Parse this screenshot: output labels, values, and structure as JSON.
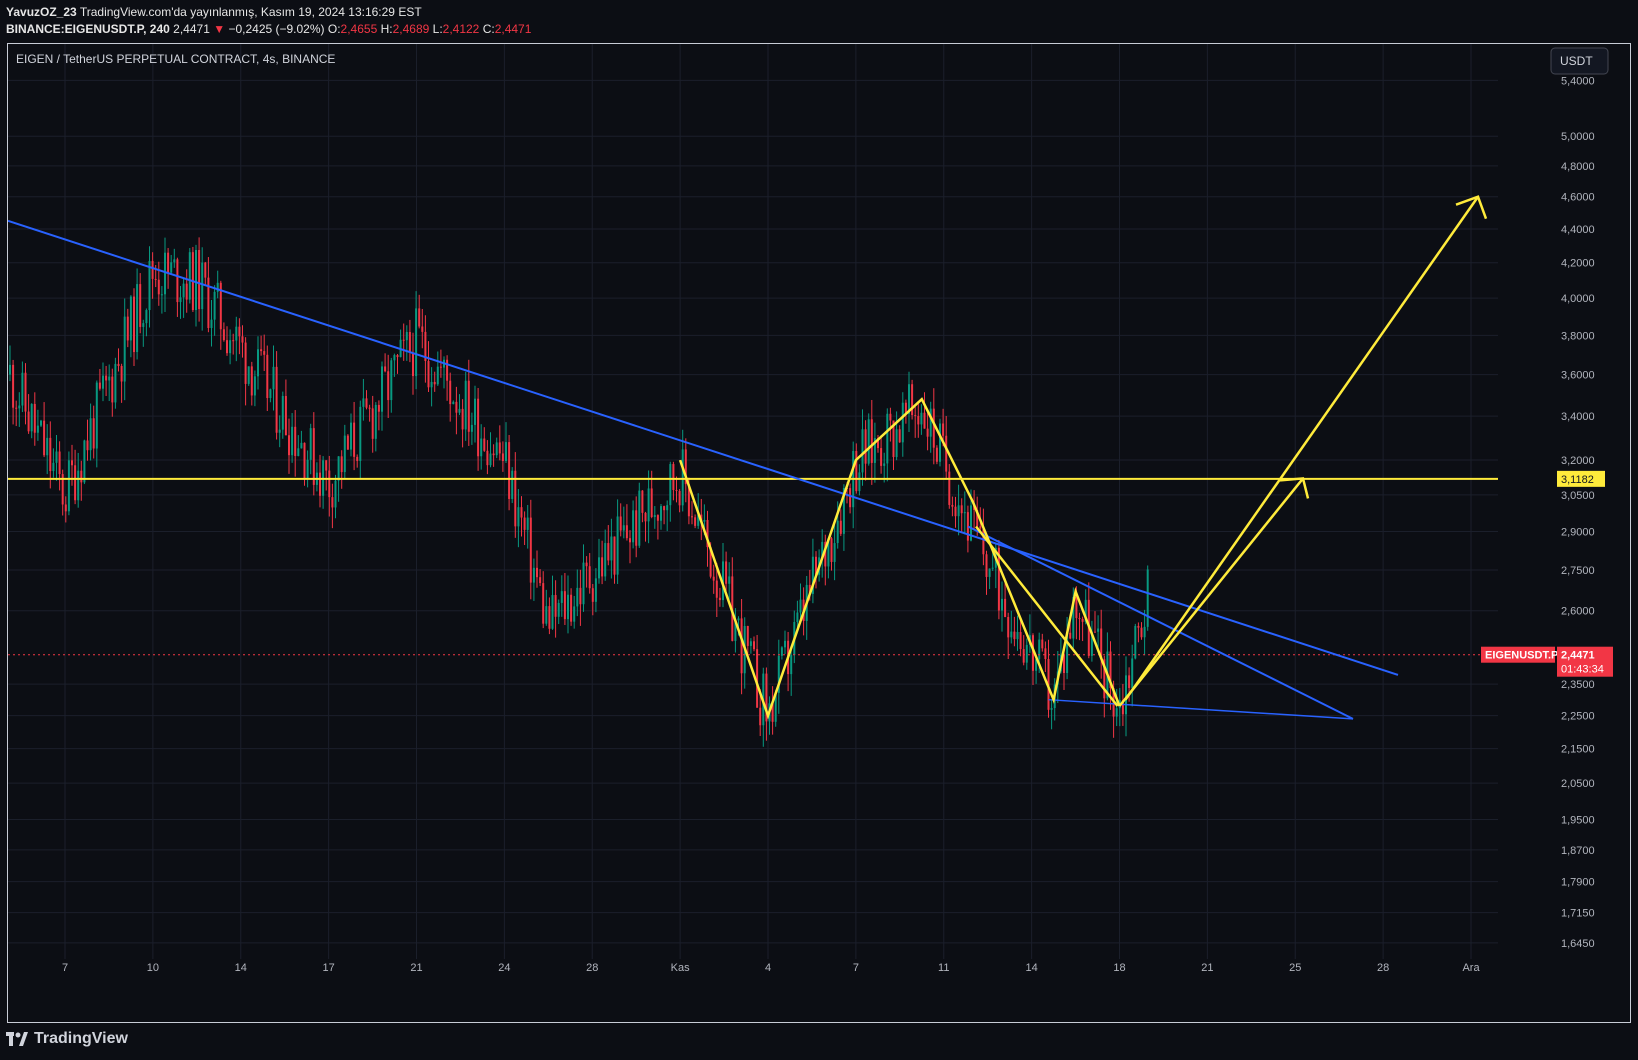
{
  "header": {
    "publisher": "YavuzOZ_23",
    "published_text": "TradingView.com'da yayınlanmış, Kasım 19, 2024 13:16:29 EST",
    "symbol_full": "BINANCE:EIGENUSDT.P, 240",
    "last": "2,4471",
    "change_arrow": "▼",
    "change": "−0,2425 (−9.02%)",
    "o_label": "O:",
    "o_value": "2,4655",
    "h_label": "H:",
    "h_value": "2,4689",
    "l_label": "L:",
    "l_value": "2,4122",
    "c_label": "C:",
    "c_value": "2,4471"
  },
  "chart_title": "EIGEN / TetherUS PERPETUAL CONTRACT, 4s, BINANCE",
  "currency_button": "USDT",
  "price_axis_labels": [
    "5,4000",
    "5,0000",
    "4,8000",
    "4,6000",
    "4,4000",
    "4,2000",
    "4,0000",
    "3,8000",
    "3,6000",
    "3,4000",
    "3,2000",
    "3,0500",
    "2,9000",
    "2,7500",
    "2,6000",
    "2,3500",
    "2,2500",
    "2,1500",
    "2,0500",
    "1,9500",
    "1,8700",
    "1,7900",
    "1,7150",
    "1,6450"
  ],
  "time_axis_labels": [
    "7",
    "10",
    "14",
    "17",
    "21",
    "24",
    "28",
    "Kas",
    "4",
    "7",
    "11",
    "14",
    "18",
    "21",
    "25",
    "28",
    "Ara"
  ],
  "horizontal_level_label": "3,1182",
  "symbol_tag": "EIGENUSDT.P",
  "last_price_tag": "2,4471",
  "countdown_tag": "01:43:34",
  "footer_brand": "TradingView",
  "colors": {
    "up": "#089981",
    "down": "#f23645",
    "trend_blue": "#2962ff",
    "pattern_yellow": "#ffeb3b",
    "background": "#0c0e14"
  },
  "chart_data": {
    "type": "candlestick",
    "symbol": "EIGENUSDT.P",
    "interval": "240",
    "y_scale": "log",
    "ylim": [
      1.62,
      5.6
    ],
    "last_close": 2.4471,
    "horizontal_level": 3.1182,
    "swing_points": [
      {
        "x": "7",
        "y": 3.05
      },
      {
        "x": "10",
        "y": 4.15
      },
      {
        "x": "12",
        "y": 4.1
      },
      {
        "x": "17",
        "y": 3.1
      },
      {
        "x": "21",
        "y": 3.78
      },
      {
        "x": "24",
        "y": 3.2
      },
      {
        "x": "26",
        "y": 2.55
      },
      {
        "x": "Kas",
        "y": 3.15
      },
      {
        "x": "4",
        "y": 2.25
      },
      {
        "x": "7",
        "y": 3.2
      },
      {
        "x": "10",
        "y": 3.45
      },
      {
        "x": "12",
        "y": 2.9
      },
      {
        "x": "15",
        "y": 2.3
      },
      {
        "x": "16",
        "y": 2.65
      },
      {
        "x": "18",
        "y": 2.28
      },
      {
        "x": "19",
        "y": 2.68
      },
      {
        "x": "19",
        "y": 2.447
      }
    ]
  }
}
